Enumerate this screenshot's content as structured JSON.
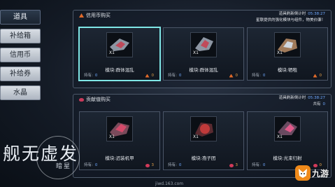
{
  "sidebar": {
    "items": [
      {
        "label": "道具",
        "active": true
      },
      {
        "label": "补给箱",
        "active": false
      },
      {
        "label": "信用币",
        "active": false
      },
      {
        "label": "补给券",
        "active": false
      },
      {
        "label": "水晶",
        "active": false
      }
    ]
  },
  "panel_credit": {
    "title": "信用币购买",
    "refresh_label": "道具刷新倒计时",
    "refresh_time": "05:38:27",
    "subtitle": "星联提供的强化模块与组件，物美价廉！",
    "cards": [
      {
        "qty": "X1",
        "name": "模块:群体混乱",
        "own_label": "持有:",
        "own_value": "0",
        "price": "0",
        "selected": true
      },
      {
        "qty": "X1",
        "name": "模块:群体混乱",
        "own_label": "持有:",
        "own_value": "0",
        "price": "0",
        "selected": false
      },
      {
        "qty": "X1",
        "name": "模块:牺牲",
        "own_label": "持有:",
        "own_value": "0",
        "price": "0",
        "selected": false
      }
    ]
  },
  "panel_contrib": {
    "title": "贡献值购买",
    "refresh_label": "道具刷新倒计时",
    "refresh_time": "05:38:27",
    "own_total_label": "共有",
    "own_total_value": "0",
    "cards": [
      {
        "qty": "X1",
        "name": "模块:迟装机甲",
        "own_label": "持有:",
        "own_value": "0",
        "price": "3"
      },
      {
        "qty": "X1",
        "name": "模块:孢子团",
        "own_label": "持有:",
        "own_value": "0",
        "price": "3"
      },
      {
        "qty": "X1",
        "name": "模块:光束归射",
        "own_label": "持有:",
        "own_value": "0",
        "price": "0"
      }
    ]
  },
  "logo": {
    "title": "舰无虚发",
    "subtitle": "暗星"
  },
  "watermark": "jiwd.163.com",
  "brand": {
    "name": "九游"
  },
  "colors": {
    "accent_blue": "#6fa8ff",
    "credit_orange": "#e06a2a",
    "contrib_red": "#d23a5a",
    "selection": "#7fe6e6"
  }
}
